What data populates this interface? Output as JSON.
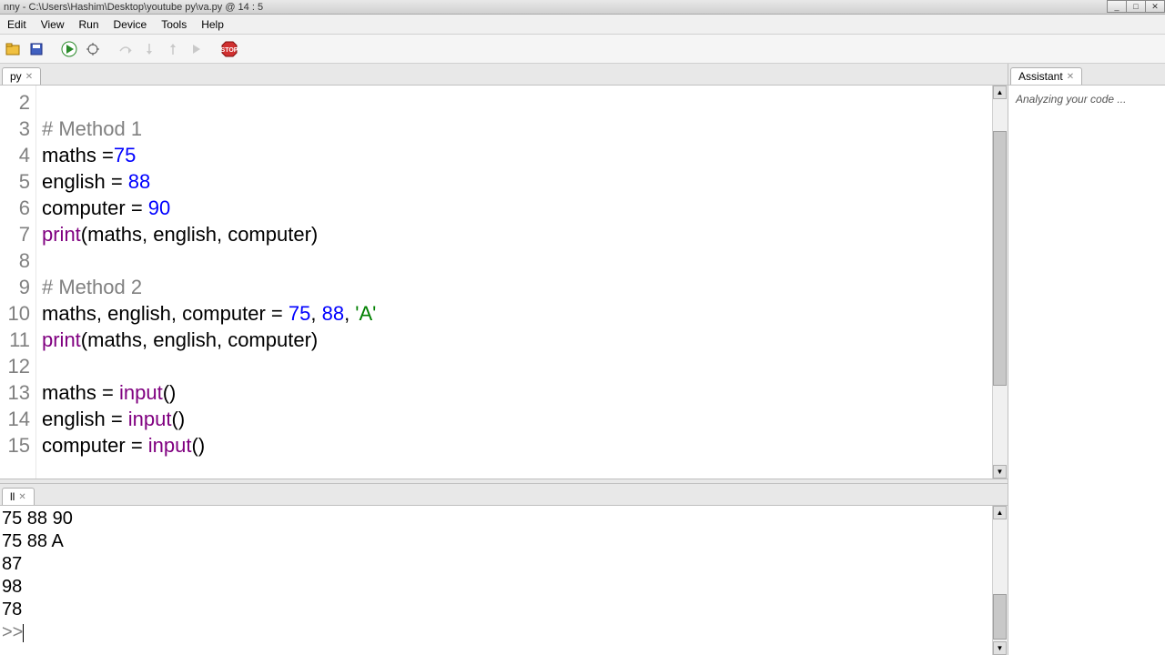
{
  "window": {
    "title": "nny  -  C:\\Users\\Hashim\\Desktop\\youtube py\\va.py  @  14 : 5"
  },
  "menu": {
    "items": [
      "Edit",
      "View",
      "Run",
      "Device",
      "Tools",
      "Help"
    ]
  },
  "tabs": {
    "editor": "py",
    "shell": "ll",
    "assistant": "Assistant"
  },
  "assistant": {
    "status": "Analyzing your code ..."
  },
  "code": {
    "lines": [
      {
        "n": 2,
        "segs": []
      },
      {
        "n": 3,
        "segs": [
          {
            "t": "# Method 1",
            "c": "c-comment"
          }
        ]
      },
      {
        "n": 4,
        "segs": [
          {
            "t": "maths ="
          },
          {
            "t": "75",
            "c": "c-num"
          }
        ]
      },
      {
        "n": 5,
        "segs": [
          {
            "t": "english = "
          },
          {
            "t": "88",
            "c": "c-num"
          }
        ]
      },
      {
        "n": 6,
        "segs": [
          {
            "t": "computer = "
          },
          {
            "t": "90",
            "c": "c-num"
          }
        ]
      },
      {
        "n": 7,
        "segs": [
          {
            "t": "print",
            "c": "c-builtin"
          },
          {
            "t": "(maths, english, computer)"
          }
        ]
      },
      {
        "n": 8,
        "segs": []
      },
      {
        "n": 9,
        "segs": [
          {
            "t": "# Method 2",
            "c": "c-comment"
          }
        ]
      },
      {
        "n": 10,
        "segs": [
          {
            "t": "maths, english, computer = "
          },
          {
            "t": "75",
            "c": "c-num"
          },
          {
            "t": ", "
          },
          {
            "t": "88",
            "c": "c-num"
          },
          {
            "t": ", "
          },
          {
            "t": "'A'",
            "c": "c-str"
          }
        ]
      },
      {
        "n": 11,
        "segs": [
          {
            "t": "print",
            "c": "c-builtin"
          },
          {
            "t": "(maths, english, computer)"
          }
        ]
      },
      {
        "n": 12,
        "segs": []
      },
      {
        "n": 13,
        "segs": [
          {
            "t": "maths = "
          },
          {
            "t": "input",
            "c": "c-builtin"
          },
          {
            "t": "()"
          }
        ]
      },
      {
        "n": 14,
        "segs": [
          {
            "t": "english = "
          },
          {
            "t": "input",
            "c": "c-builtin"
          },
          {
            "t": "()"
          }
        ]
      },
      {
        "n": 15,
        "segs": [
          {
            "t": "computer = "
          },
          {
            "t": "input",
            "c": "c-builtin"
          },
          {
            "t": "()"
          }
        ]
      }
    ]
  },
  "shell": {
    "lines": [
      "75 88 90",
      "75 88 A",
      "87",
      "98",
      "78"
    ],
    "prompt": ">>"
  },
  "icons": {
    "open": "open-icon",
    "save": "save-icon",
    "run": "run-icon",
    "debug": "debug-icon",
    "stepover": "step-over-icon",
    "stepin": "step-in-icon",
    "stepout": "step-out-icon",
    "resume": "resume-icon",
    "stop": "stop-icon"
  }
}
